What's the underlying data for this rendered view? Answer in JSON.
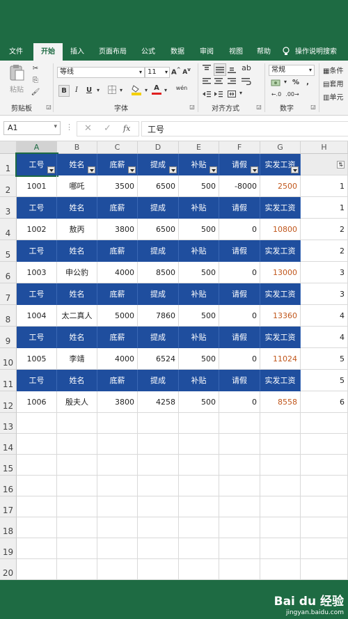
{
  "ribbon_tabs": [
    "文件",
    "开始",
    "插入",
    "页面布局",
    "公式",
    "数据",
    "审阅",
    "视图",
    "帮助"
  ],
  "active_tab": "开始",
  "tell_me": "操作说明搜索",
  "clipboard": {
    "paste": "粘贴",
    "group": "剪贴板"
  },
  "font": {
    "name": "等线",
    "size": "11",
    "group": "字体",
    "bold": "B",
    "italic": "I",
    "underline": "U",
    "grow": "A",
    "shrink": "A",
    "font_color": "A",
    "phonetic": "wén"
  },
  "alignment": {
    "group": "对齐方式"
  },
  "number": {
    "format": "常规",
    "group": "数字",
    "percent": "%",
    "comma": ","
  },
  "styles": {
    "cond_format": "条件",
    "table_format": "套用",
    "cell_styles": "单元"
  },
  "formula_bar": {
    "name_box": "A1",
    "cancel": "✕",
    "enter": "✓",
    "fx": "fx",
    "content": "工号"
  },
  "columns": [
    "A",
    "B",
    "C",
    "D",
    "E",
    "F",
    "G",
    "H"
  ],
  "rows": [
    "1",
    "2",
    "3",
    "4",
    "5",
    "6",
    "7",
    "8",
    "9",
    "10",
    "11",
    "12",
    "13",
    "14",
    "15",
    "16",
    "17",
    "18",
    "19",
    "20"
  ],
  "header": [
    "工号",
    "姓名",
    "底薪",
    "提成",
    "补贴",
    "请假",
    "实发工资"
  ],
  "records": [
    [
      "1001",
      "哪吒",
      "3500",
      "6500",
      "500",
      "-8000",
      "2500",
      "1"
    ],
    [
      "1002",
      "敖丙",
      "3800",
      "6500",
      "500",
      "0",
      "10800",
      "2"
    ],
    [
      "1003",
      "申公豹",
      "4000",
      "8500",
      "500",
      "0",
      "13000",
      "3"
    ],
    [
      "1004",
      "太二真人",
      "5000",
      "7860",
      "500",
      "0",
      "13360",
      "4"
    ],
    [
      "1005",
      "李靖",
      "4000",
      "6524",
      "500",
      "0",
      "11024",
      "5"
    ],
    [
      "1006",
      "殷夫人",
      "3800",
      "4258",
      "500",
      "0",
      "8558",
      "6"
    ]
  ],
  "header_h": [
    "1",
    "2",
    "3",
    "4",
    "5"
  ],
  "watermark": {
    "brand": "Bai du 经验",
    "url": "jingyan.baidu.com"
  }
}
